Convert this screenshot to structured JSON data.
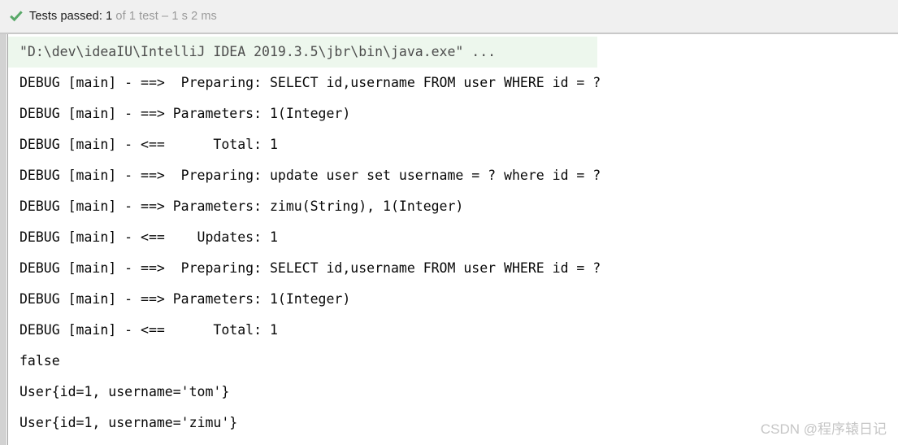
{
  "status_bar": {
    "icon": "check-icon",
    "icon_color": "#59a869",
    "label": "Tests passed:",
    "count": "1",
    "detail": " of 1 test – 1 s 2 ms",
    "full_text": "Tests passed: 1 of 1 test – 1 s 2 ms"
  },
  "console": {
    "command_line": "\"D:\\dev\\ideaIU\\IntelliJ IDEA 2019.3.5\\jbr\\bin\\java.exe\" ...",
    "highlight_color": "#edf7ed",
    "lines": [
      "DEBUG [main] - ==>  Preparing: SELECT id,username FROM user WHERE id = ?",
      "DEBUG [main] - ==> Parameters: 1(Integer)",
      "DEBUG [main] - <==      Total: 1",
      "DEBUG [main] - ==>  Preparing: update user set username = ? where id = ?",
      "DEBUG [main] - ==> Parameters: zimu(String), 1(Integer)",
      "DEBUG [main] - <==    Updates: 1",
      "DEBUG [main] - ==>  Preparing: SELECT id,username FROM user WHERE id = ?",
      "DEBUG [main] - ==> Parameters: 1(Integer)",
      "DEBUG [main] - <==      Total: 1",
      "false",
      "User{id=1, username='tom'}",
      "User{id=1, username='zimu'}"
    ]
  },
  "watermark": {
    "text": "CSDN @程序辕日记"
  }
}
